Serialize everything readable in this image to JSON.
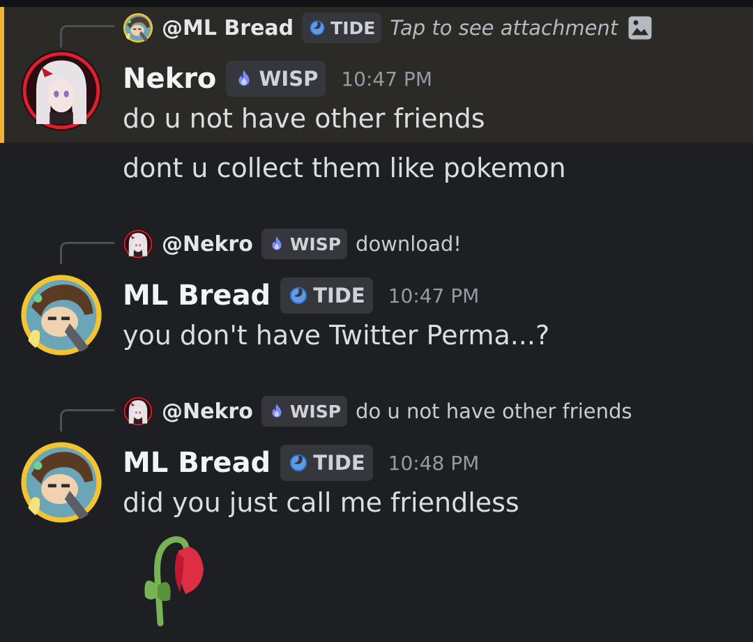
{
  "messages": [
    {
      "reply": {
        "user": "@ML Bread",
        "tag": "TIDE",
        "text": "Tap to see attachment",
        "attachment_icon": "image-icon"
      },
      "author": "Nekro",
      "tag": "WISP",
      "time": "10:47 PM",
      "lines": [
        "do u not have other friends",
        "dont u collect them like pokemon"
      ],
      "highlighted": true
    },
    {
      "reply": {
        "user": "@Nekro",
        "tag": "WISP",
        "text": "download!"
      },
      "author": "ML Bread",
      "tag": "TIDE",
      "time": "10:47 PM",
      "lines": [
        "you don't have Twitter Perma...?"
      ]
    },
    {
      "reply": {
        "user": "@Nekro",
        "tag": "WISP",
        "text": "do u not have other friends"
      },
      "author": "ML Bread",
      "tag": "TIDE",
      "time": "10:48 PM",
      "lines": [
        "did you just call me friendless"
      ],
      "emoji": "wilted-flower-emoji"
    }
  ],
  "colors": {
    "background": "#1e1f22",
    "highlight": "#2c2a26",
    "highlight_bar": "#f0b232",
    "tag_bg": "#35373c",
    "wisp": "#7b8cff",
    "tide": "#5b9bea"
  }
}
